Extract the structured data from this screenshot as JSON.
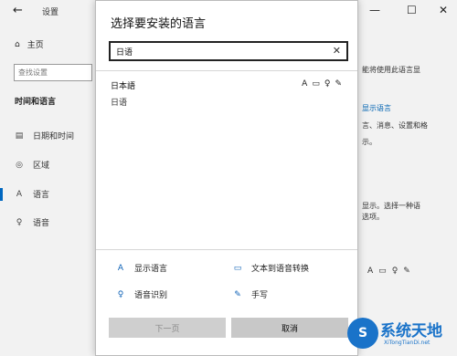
{
  "window": {
    "title": "设置",
    "back_glyph": "←",
    "minimize_glyph": "—",
    "maximize_glyph": "☐",
    "close_glyph": "✕"
  },
  "nav": {
    "home": "主页",
    "search_placeholder": "查找设置",
    "section": "时间和语言",
    "items": [
      {
        "label": "日期和时间",
        "icon": "calendar-icon"
      },
      {
        "label": "区域",
        "icon": "globe-icon"
      },
      {
        "label": "语言",
        "icon": "language-icon"
      },
      {
        "label": "语音",
        "icon": "microphone-icon"
      }
    ]
  },
  "right_pane": {
    "line1": "能将使用此语言显",
    "line2": "显示语言",
    "line3": "言、消息、设置和格",
    "line4": "示。",
    "line5": "显示。选择一种语",
    "line6": "选项。"
  },
  "dialog": {
    "title": "选择要安装的语言",
    "search_value": "日语",
    "clear_glyph": "✕",
    "result": {
      "native": "日本語",
      "translated": "日语",
      "features": [
        "display-language-icon",
        "text-to-speech-icon",
        "speech-recognition-icon",
        "handwriting-icon"
      ]
    },
    "legend": [
      {
        "label": "显示语言",
        "icon": "display-language-icon"
      },
      {
        "label": "文本到语音转换",
        "icon": "text-to-speech-icon"
      },
      {
        "label": "语音识别",
        "icon": "speech-recognition-icon"
      },
      {
        "label": "手写",
        "icon": "handwriting-icon"
      }
    ],
    "next_button": "下一页",
    "cancel_button": "取消"
  },
  "watermark": {
    "brand": "系统天地",
    "url": "XiTongTianDi.net",
    "logo_letter": "S"
  },
  "colors": {
    "accent": "#0067c0",
    "watermark": "#1a73c9"
  }
}
